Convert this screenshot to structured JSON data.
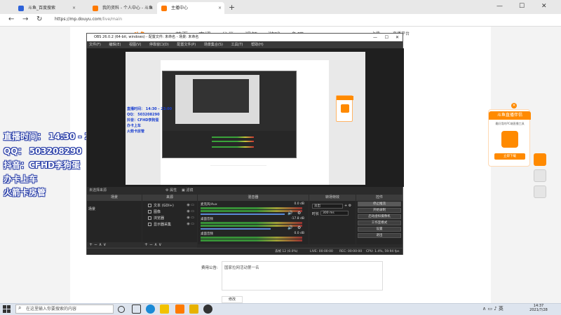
{
  "browser": {
    "tabs": [
      {
        "label": "斗鱼_百度搜索",
        "color": "#2d62d9"
      },
      {
        "label": "我的资料 - 个人中心 - 斗鱼",
        "color": "#ff7a00"
      },
      {
        "label": "主播中心",
        "color": "#ff7a00"
      }
    ],
    "new_tab": "+",
    "close_glyph": "×",
    "minimize": "—",
    "maximize": "☐",
    "close": "✕",
    "back": "←",
    "forward": "→",
    "refresh": "↻",
    "url_host": "https://mp.douyu.com",
    "url_path": "/live/main"
  },
  "site": {
    "nav": [
      "首页",
      "直播",
      "分类",
      "视频",
      "游戏",
      "鱼吧"
    ],
    "right_items": [
      "上传",
      "直播平台"
    ]
  },
  "overlay": {
    "lines": [
      "直播时间： 14:30 - 23:00",
      "QQ： 503208290",
      "抖音：CFHD李狗蛋",
      "办卡上车",
      "火箭卡房管"
    ],
    "stroke_color": "#2a3fa8"
  },
  "ad": {
    "title": "斗鱼直播伴侣",
    "subtitle": "最好用的PC端直播工具",
    "download": "立即下载",
    "close": "×",
    "brand_color": "#ff8a00"
  },
  "obs": {
    "title": "OBS 26.0.2 (64-bit, windows) - 配置文件: 未命名 - 场景: 未命名",
    "menu": [
      "文件(F)",
      "编辑(E)",
      "视图(V)",
      "停靠窗口(D)",
      "配置文件(P)",
      "场景集合(S)",
      "工具(T)",
      "帮助(H)"
    ],
    "scene_info": "未选择来源",
    "props_btn": "属性",
    "filters_btn": "滤镜",
    "docks": {
      "scenes": "场景",
      "sources": "来源",
      "mixer": "混音器",
      "transitions": "转场特效",
      "controls": "控件"
    },
    "scene_item": "场景",
    "sources": [
      "文本 (GDI+)",
      "图像",
      "浏览器",
      "显示器采集"
    ],
    "mixer": [
      {
        "name": "麦克风/Aux",
        "db": "0.0 dB"
      },
      {
        "name": "桌面音频",
        "db": "-17.8 dB"
      },
      {
        "name": "桌面音频",
        "db": "0.0 dB"
      }
    ],
    "transition": "淡出",
    "duration_label": "时长",
    "duration": "300 ms",
    "controls": [
      "停止推流",
      "开始录制",
      "启动虚拟摄像机",
      "工作室模式",
      "设置",
      "退出"
    ],
    "status": {
      "dropped": "丢帧 12 (0.0%)",
      "live": "LIVE: 00:00:00",
      "rec": "REC: 00:00:00",
      "cpu": "CPU: 1.4%, 59.94 fps"
    },
    "footer_glyphs": "+ −  ∧  ∨"
  },
  "inner": {
    "lines": [
      "直播时间： 14:30 - 23:00",
      "QQ： 503208290",
      "抖音：CFHD李狗蛋",
      "办卡上车",
      "火箭卡房管"
    ]
  },
  "form": {
    "fee_label": "费用公告:",
    "fee_text": "国家拉网活动第一名",
    "edit": "修改"
  },
  "taskbar": {
    "search_placeholder": "在这里输入你要搜索的内容",
    "time": "14:37",
    "date": "2021/7/28",
    "tray": "∧ ▭ ♪ 英"
  }
}
